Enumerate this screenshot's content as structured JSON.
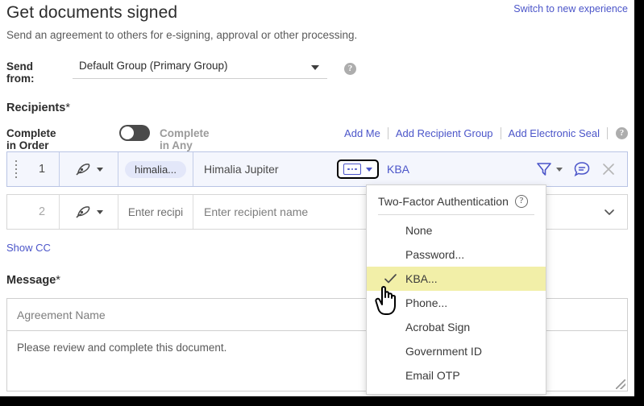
{
  "header": {
    "title": "Get documents signed",
    "subtitle": "Send an agreement to others for e-signing, approval or other processing.",
    "switch_link": "Switch to new experience"
  },
  "send_from": {
    "label": "Send from:",
    "value": "Default Group (Primary Group)",
    "help_icon": "help-icon",
    "caret_icon": "caret-down-icon"
  },
  "recipients": {
    "heading": "Recipients",
    "required_mark": "*",
    "order_on_label": "Complete in Order",
    "order_off_label": "Complete in Any Order",
    "toggle_state": "Complete in Order",
    "links": [
      {
        "label": "Add Me",
        "name": "add-me-link"
      },
      {
        "label": "Add Recipient Group",
        "name": "add-recipient-group-link"
      },
      {
        "label": "Add Electronic Seal",
        "name": "add-electronic-seal-link"
      }
    ],
    "help_icon": "help-icon",
    "rows": [
      {
        "number": "1",
        "role": "himalia...",
        "name_value": "Himalia Jupiter",
        "auth_label": "KBA",
        "pen_icon": "signature-pen-icon",
        "delivery_icon": "delivery-funnel-icon",
        "message_icon": "chat-bubble-icon",
        "remove_icon": "close-x-icon"
      },
      {
        "number": "2",
        "role": "Enter recipi",
        "name_placeholder": "Enter recipient name",
        "pen_icon": "signature-pen-icon",
        "chevron_icon": "chevron-down-icon"
      }
    ]
  },
  "auth_menu": {
    "title": "Two-Factor Authentication",
    "help_icon": "question-mark-icon",
    "selected": "KBA...",
    "items": [
      "None",
      "Password...",
      "KBA...",
      "Phone...",
      "Acrobat Sign",
      "Government ID",
      "Email OTP"
    ]
  },
  "show_cc": {
    "label": "Show CC"
  },
  "message": {
    "heading": "Message",
    "required_mark": "*",
    "name_placeholder": "Agreement Name",
    "body_text": "Please review and complete this document.",
    "resize_icon": "resize-grip-icon"
  },
  "colors": {
    "accent_blue": "#4b55c9",
    "highlight_yellow": "#f2efa8",
    "row_selected_bg": "#f4f6fd",
    "chip_bg": "#e3e7f9"
  }
}
